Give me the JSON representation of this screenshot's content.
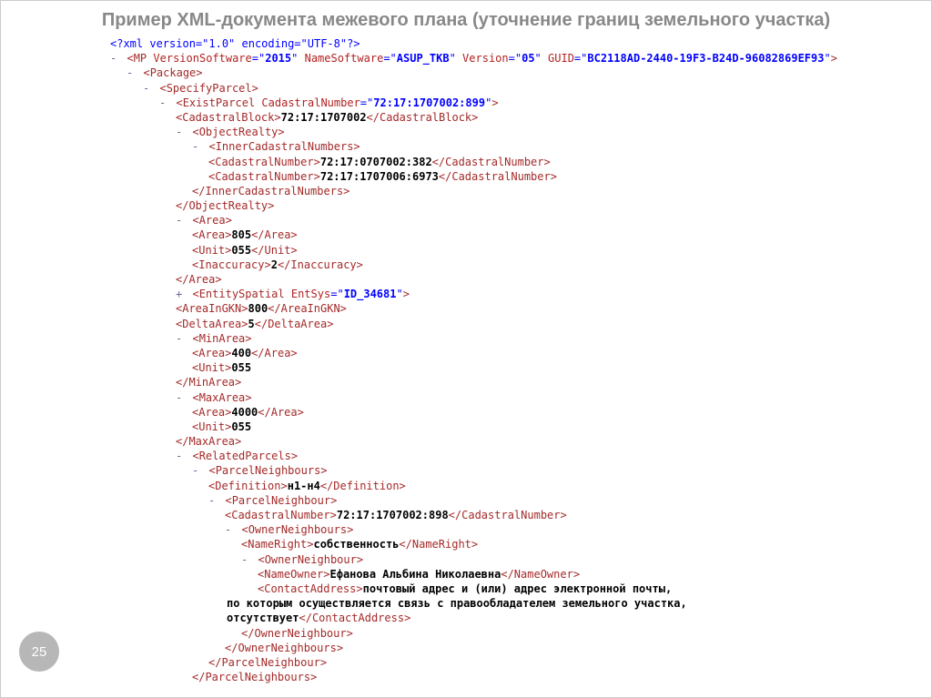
{
  "title": "Пример XML-документа межевого плана (уточнение границ земельного участка)",
  "page_number": "25",
  "xml_decl": "<?xml version=\"1.0\" encoding=\"UTF-8\"?>",
  "mp": {
    "tag": "MP",
    "attrs": {
      "VersionSoftware_name": "VersionSoftware",
      "VersionSoftware_val": "2015",
      "NameSoftware_name": "NameSoftware",
      "NameSoftware_val": "ASUP_TKB",
      "Version_name": "Version",
      "Version_val": "05",
      "GUID_name": "GUID",
      "GUID_val": "BC2118AD-2440-19F3-B24D-96082869EF93"
    }
  },
  "pkg": "Package",
  "specify": "SpecifyParcel",
  "exist": {
    "tag": "ExistParcel",
    "attr_name": "CadastralNumber",
    "attr_val": "72:17:1707002:899"
  },
  "cb": {
    "tag": "CadastralBlock",
    "val": "72:17:1707002"
  },
  "objrealty": "ObjectRealty",
  "icn_wrap": "InnerCadastralNumbers",
  "cn": "CadastralNumber",
  "cn1": "72:17:0707002:382",
  "cn2": "72:17:1707006:6973",
  "area_tag": "Area",
  "area_val": "805",
  "unit_tag": "Unit",
  "unit_val": "055",
  "inacc_tag": "Inaccuracy",
  "inacc_val": "2",
  "entity": {
    "tag": "EntitySpatial",
    "attr_name": "EntSys",
    "attr_val": "ID_34681"
  },
  "areaingkn_tag": "AreaInGKN",
  "areaingkn_val": "800",
  "deltaarea_tag": "DeltaArea",
  "deltaarea_val": "5",
  "minarea_tag": "MinArea",
  "minarea_area": "400",
  "minarea_unit": "055",
  "maxarea_tag": "MaxArea",
  "maxarea_area": "4000",
  "maxarea_unit": "055",
  "related_tag": "RelatedParcels",
  "pneighs_tag": "ParcelNeighbours",
  "def_tag": "Definition",
  "def_val": "н1-н4",
  "pneigh_tag": "ParcelNeighbour",
  "pneigh_cn": "72:17:1707002:898",
  "owneighs_tag": "OwnerNeighbours",
  "nameright_tag": "NameRight",
  "nameright_val": "собственность",
  "owneigh_tag": "OwnerNeighbour",
  "nameowner_tag": "NameOwner",
  "nameowner_val": "Ефанова Альбина Николаевна",
  "contact_tag": "ContactAddress",
  "contact_l1": "почтовый адрес и (или) адрес электронной почты,",
  "contact_l2": "по которым осуществляется связь с правообладателем земельного участка,",
  "contact_l3": "отсутствует"
}
